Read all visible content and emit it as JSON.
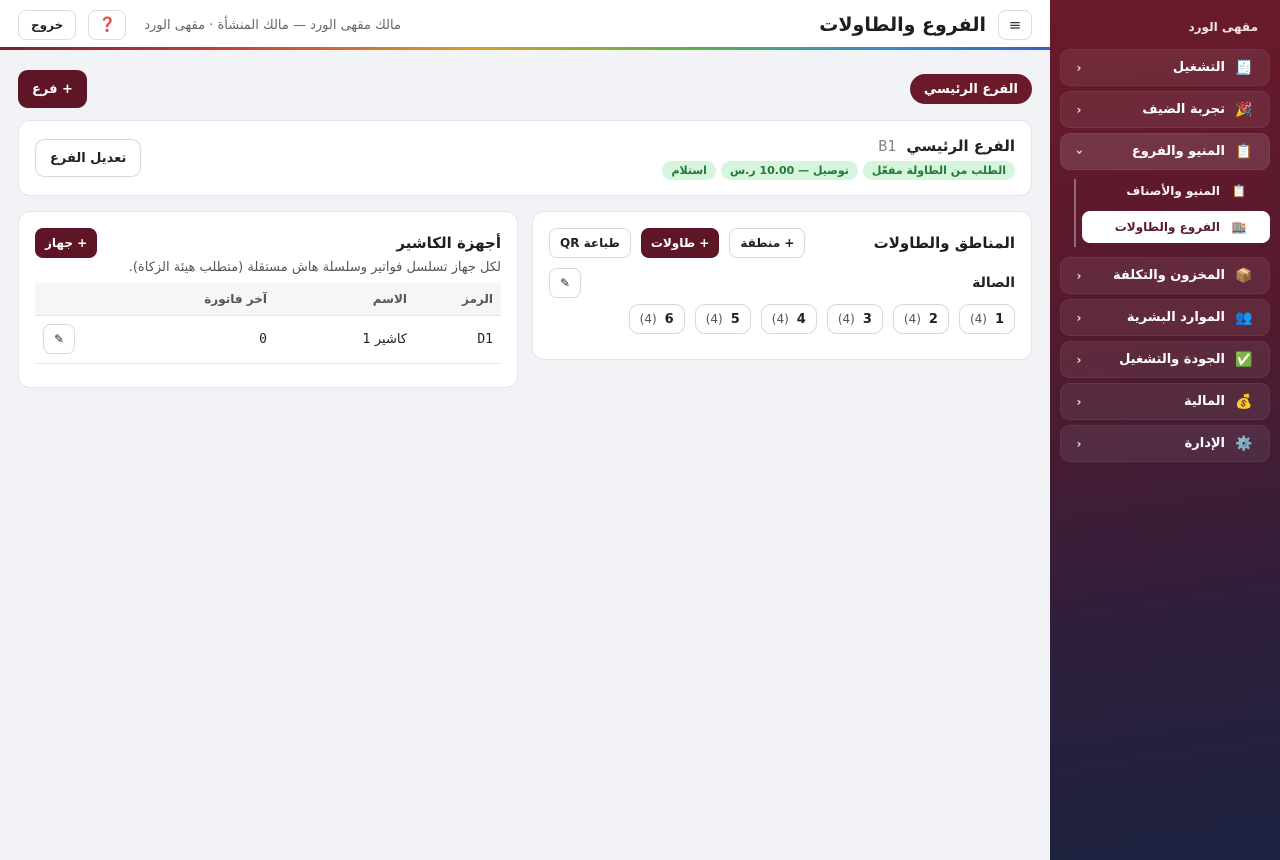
{
  "sidebar": {
    "brand": "مقهى الورد",
    "items": [
      {
        "icon": "🧾",
        "label": "التشغيل"
      },
      {
        "icon": "🎉",
        "label": "تجربة الضيف"
      },
      {
        "icon": "📋",
        "label": "المنيو والفروع"
      },
      {
        "icon": "📦",
        "label": "المخزون والتكلفة"
      },
      {
        "icon": "👥",
        "label": "الموارد البشرية"
      },
      {
        "icon": "✅",
        "label": "الجودة والتشغيل"
      },
      {
        "icon": "💰",
        "label": "المالية"
      },
      {
        "icon": "⚙️",
        "label": "الإدارة"
      }
    ],
    "chev_closed": "‹",
    "chev_open": "›",
    "sub_items": [
      {
        "icon": "📋",
        "label": "المنيو والأصناف"
      },
      {
        "icon": "🏬",
        "label": "الفروع والطاولات"
      }
    ]
  },
  "topbar": {
    "menu_icon": "≡",
    "title": "الفروع والطاولات",
    "context": "مالك مقهى الورد — مالك المنشأة · مقهى الورد",
    "help_icon": "❓",
    "logout_label": "خروج"
  },
  "branch_selector": {
    "label": "الفرع الرئيسي"
  },
  "add_branch_label": "+ فرع",
  "branch": {
    "name": "الفرع الرئيسي",
    "code": "B1",
    "tags": [
      "الطلب من الطاولة مفعّل",
      "توصيل — 10.00 ر.س",
      "استلام"
    ],
    "edit_label": "تعديل الفرع"
  },
  "zones": {
    "title": "المناطق والطاولات",
    "add_zone_label": "+ منطقة",
    "add_tables_label": "+ طاولات",
    "print_qr_label": "طباعة QR",
    "pencil_icon": "✎",
    "zone_name": "الصالة",
    "tables": [
      {
        "num": "1",
        "cap": "(4)"
      },
      {
        "num": "2",
        "cap": "(4)"
      },
      {
        "num": "3",
        "cap": "(4)"
      },
      {
        "num": "4",
        "cap": "(4)"
      },
      {
        "num": "5",
        "cap": "(4)"
      },
      {
        "num": "6",
        "cap": "(4)"
      }
    ]
  },
  "pos": {
    "title": "أجهزة الكاشير",
    "add_device_label": "+ جهاز",
    "description": "لكل جهاز تسلسل فواتير وسلسلة هاش مستقلة (متطلب هيئة الزكاة).",
    "columns": [
      "الرمز",
      "الاسم",
      "آخر فاتورة"
    ],
    "rows": [
      {
        "code": "D1",
        "name": "كاشير 1",
        "last_invoice": "0"
      }
    ],
    "pencil_icon": "✎"
  }
}
